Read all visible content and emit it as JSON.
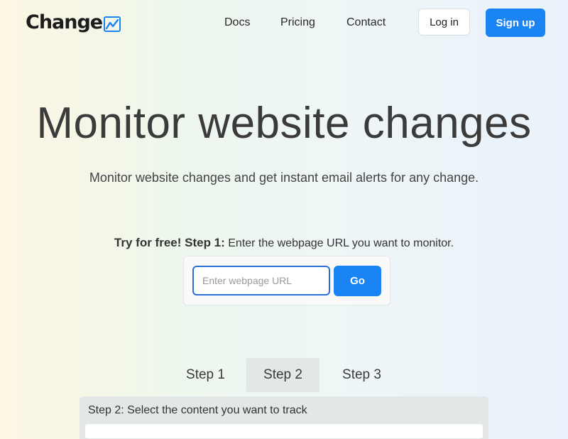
{
  "header": {
    "logo_text": "Change",
    "logo_icon": "trend-chart-icon",
    "nav": [
      "Docs",
      "Pricing",
      "Contact"
    ],
    "login_label": "Log in",
    "signup_label": "Sign up"
  },
  "hero": {
    "title": "Monitor website changes",
    "subtitle": "Monitor website changes and get instant email alerts for any change.",
    "try_strong": "Try for free! Step 1:",
    "try_text": " Enter the webpage URL you want to monitor.",
    "url_placeholder": "Enter webpage URL",
    "go_label": "Go"
  },
  "steps": {
    "tabs": [
      "Step 1",
      "Step 2",
      "Step 3"
    ],
    "active_index": 1,
    "panel_title": "Step 2: Select the content you want to track"
  },
  "colors": {
    "accent": "#1a84f5",
    "input_border": "#2b6fd8",
    "active_tab_bg": "#e3e7e6"
  }
}
